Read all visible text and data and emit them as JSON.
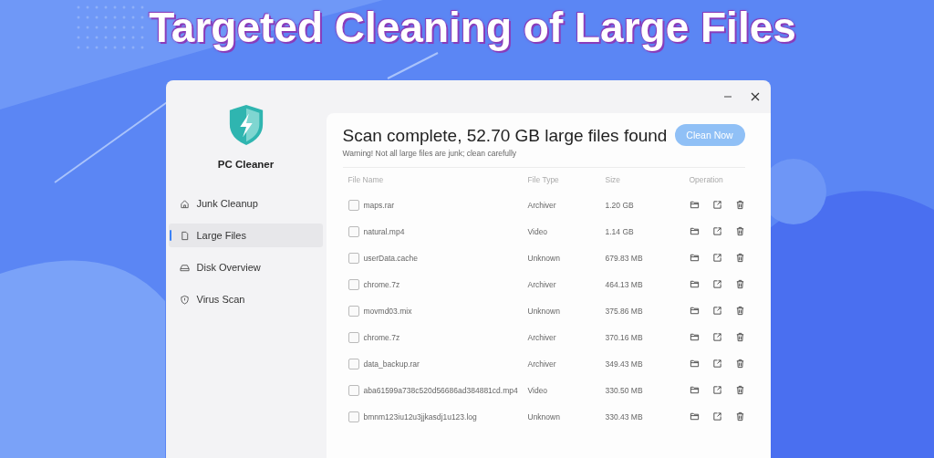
{
  "headline": "Targeted Cleaning of Large Files",
  "app": {
    "name": "PC Cleaner",
    "nav": [
      {
        "label": "Junk Cleanup",
        "kind": "home",
        "selected": false
      },
      {
        "label": "Large Files",
        "kind": "file",
        "selected": true
      },
      {
        "label": "Disk Overview",
        "kind": "disk",
        "selected": false
      },
      {
        "label": "Virus Scan",
        "kind": "shield",
        "selected": false
      }
    ],
    "title": "Scan complete, 52.70 GB large files found",
    "warning": "Warning! Not all large files are junk; clean carefully",
    "clean_button": "Clean Now",
    "columns": [
      "File Name",
      "File Type",
      "Size",
      "Operation"
    ],
    "rows": [
      {
        "name": "maps.rar",
        "type": "Archiver",
        "size": "1.20 GB",
        "checked": false
      },
      {
        "name": "natural.mp4",
        "type": "Video",
        "size": "1.14 GB",
        "checked": false
      },
      {
        "name": "userData.cache",
        "type": "Unknown",
        "size": "679.83 MB",
        "checked": false
      },
      {
        "name": "chrome.7z",
        "type": "Archiver",
        "size": "464.13 MB",
        "checked": false
      },
      {
        "name": "movmd03.mix",
        "type": "Unknown",
        "size": "375.86 MB",
        "checked": false
      },
      {
        "name": "chrome.7z",
        "type": "Archiver",
        "size": "370.16 MB",
        "checked": false
      },
      {
        "name": "data_backup.rar",
        "type": "Archiver",
        "size": "349.43 MB",
        "checked": false
      },
      {
        "name": "aba61599a738c520d56686ad384881cd.mp4",
        "type": "Video",
        "size": "330.50 MB",
        "checked": false
      },
      {
        "name": "bmnm123iu12u3jjkasdj1u123.log",
        "type": "Unknown",
        "size": "330.43 MB",
        "checked": false
      }
    ]
  }
}
